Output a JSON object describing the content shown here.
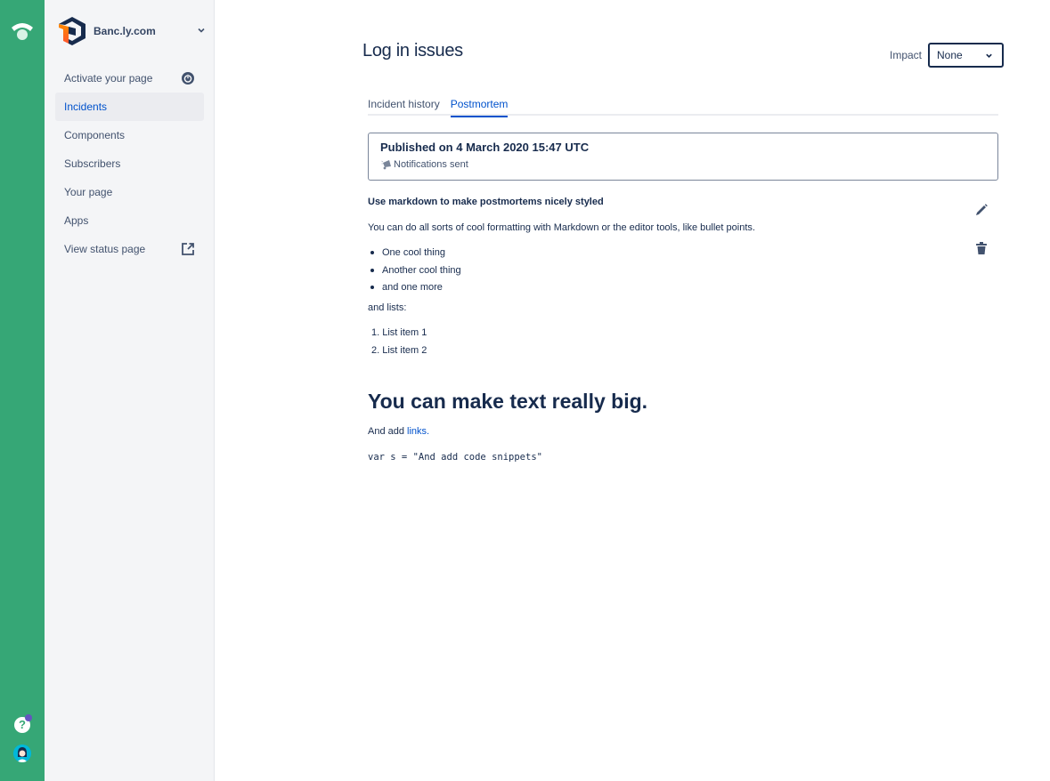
{
  "rail": {
    "logo_icon": "statuspage-logo-icon",
    "help_icon": "help-icon",
    "avatar_icon": "user-avatar"
  },
  "sidebar": {
    "brand": {
      "name": "Banc.ly.com",
      "logo_icon": "company-logo-icon"
    },
    "items": [
      {
        "label": "Activate your page",
        "icon": "power-icon",
        "active": false
      },
      {
        "label": "Incidents",
        "active": true
      },
      {
        "label": "Components",
        "active": false
      },
      {
        "label": "Subscribers",
        "active": false
      },
      {
        "label": "Your page",
        "active": false
      },
      {
        "label": "Apps",
        "active": false
      },
      {
        "label": "View status page",
        "icon": "external-link-icon",
        "active": false
      }
    ]
  },
  "header": {
    "title": "Log in issues",
    "impact_label": "Impact",
    "impact_value": "None"
  },
  "tabs": [
    {
      "label": "Incident history",
      "active": false
    },
    {
      "label": "Postmortem",
      "active": true
    }
  ],
  "publication": {
    "title": "Published on 4 March 2020 15:47 UTC",
    "notifications": "Notifications sent"
  },
  "postmortem": {
    "heading": "Use markdown to make postmortems nicely styled",
    "intro": "You can do all sorts of cool formatting with Markdown or the editor tools, like bullet points.",
    "bullets": [
      "One cool thing",
      "Another cool thing",
      "and one more"
    ],
    "lists_intro": "and lists:",
    "numbered": [
      "1. List item 1",
      "2. List item 2"
    ],
    "big_text": "You can make text really big.",
    "link_prefix": "And add ",
    "link_text": "links.",
    "code": "var s = \"And add code snippets\""
  },
  "actions": {
    "edit_icon": "pencil-icon",
    "delete_icon": "trash-icon"
  },
  "colors": {
    "rail": "#36a776",
    "accent": "#0052cc",
    "text": "#172b4d"
  }
}
